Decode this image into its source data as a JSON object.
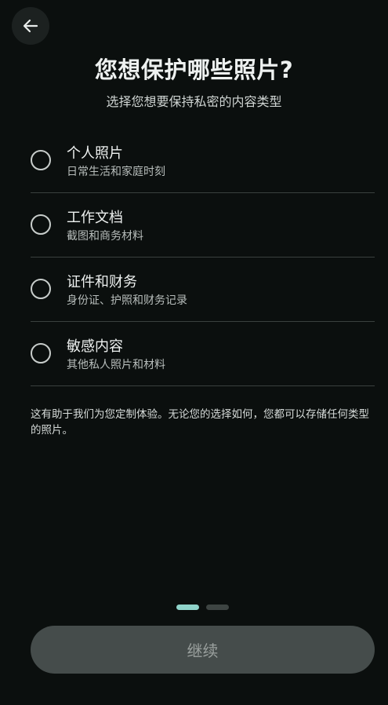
{
  "header": {
    "back_icon": "arrow-left-icon",
    "title": "您想保护哪些照片?",
    "subtitle": "选择您想要保持私密的内容类型"
  },
  "options": [
    {
      "title": "个人照片",
      "description": "日常生活和家庭时刻",
      "selected": false
    },
    {
      "title": "工作文档",
      "description": "截图和商务材料",
      "selected": false
    },
    {
      "title": "证件和财务",
      "description": "身份证、护照和财务记录",
      "selected": false
    },
    {
      "title": "敏感内容",
      "description": "其他私人照片和材料",
      "selected": false
    }
  ],
  "note": "这有助于我们为您定制体验。无论您的选择如何，您都可以存储任何类型的照片。",
  "pagination": {
    "current": 1,
    "total": 2
  },
  "continue_label": "继续",
  "colors": {
    "background": "#0b0f0e",
    "accent": "#8fd3c9",
    "button_disabled": "#454c4b"
  }
}
